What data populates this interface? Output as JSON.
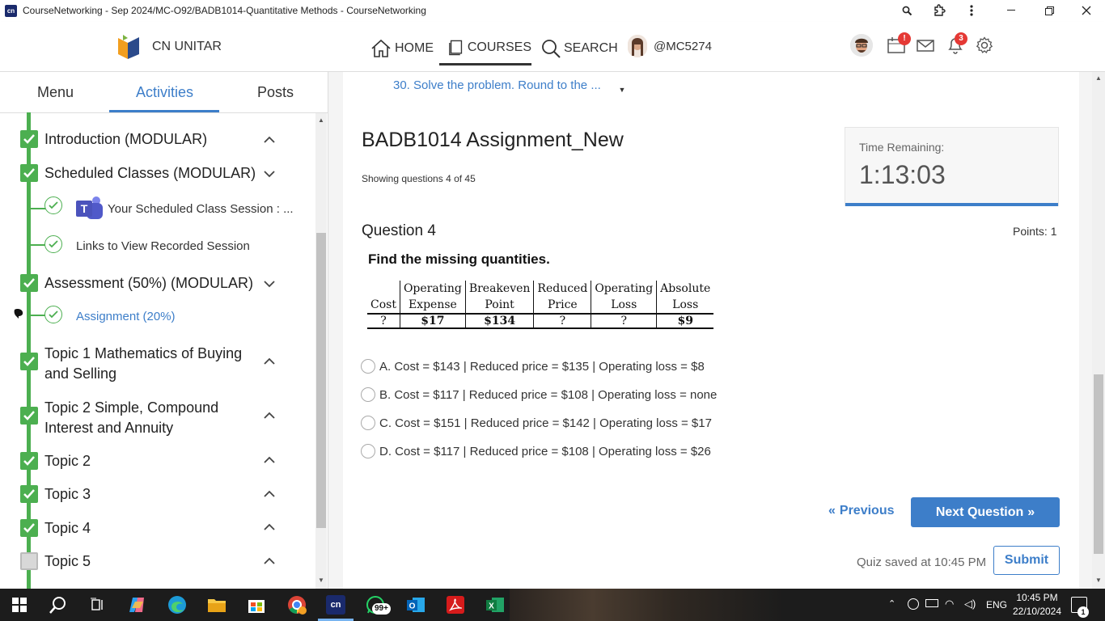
{
  "window": {
    "title": "CourseNetworking - Sep 2024/MC-O92/BADB1014-Quantitative Methods - CourseNetworking",
    "app_icon_text": "cn"
  },
  "header": {
    "brand": "CN UNITAR",
    "nav": {
      "home": "HOME",
      "courses": "COURSES",
      "search": "SEARCH"
    },
    "handle": "@MC5274",
    "calendar_badge": "!",
    "notification_badge": "3"
  },
  "sidebar": {
    "tabs": {
      "menu": "Menu",
      "activities": "Activities",
      "posts": "Posts"
    },
    "sections": [
      {
        "title": "Introduction (MODULAR)",
        "state": "done",
        "expanded": false
      },
      {
        "title": "Scheduled Classes (MODULAR)",
        "state": "done",
        "expanded": true
      },
      {
        "title": "Assessment (50%) (MODULAR)",
        "state": "done",
        "expanded": true
      },
      {
        "title": "Topic 1 Mathematics of Buying and Selling",
        "state": "done",
        "expanded": false
      },
      {
        "title": "Topic 2 Simple, Compound Interest and Annuity",
        "state": "done",
        "expanded": false
      },
      {
        "title": "Topic 2",
        "state": "done",
        "expanded": false
      },
      {
        "title": "Topic 3",
        "state": "done",
        "expanded": false
      },
      {
        "title": "Topic 4",
        "state": "done",
        "expanded": false
      },
      {
        "title": "Topic 5",
        "state": "pending",
        "expanded": false
      }
    ],
    "subitems": {
      "class_session": "Your Scheduled Class Session : ...",
      "recorded": "Links to View Recorded Session",
      "assignment": "Assignment (20%)"
    }
  },
  "main": {
    "question_select": "30. Solve the problem. Round to the ...",
    "quiz_title": "BADB1014 Assignment_New",
    "showing": "Showing questions 4 of 45",
    "timer": {
      "label": "Time Remaining:",
      "value": "1:13:03",
      "progress": 1.0
    },
    "question_number": "Question 4",
    "points": "Points: 1",
    "prompt": "Find the missing quantities.",
    "table": {
      "headers_top": [
        "",
        "Operating",
        "Breakeven",
        "Reduced",
        "Operating",
        "Absolute"
      ],
      "headers_bottom": [
        "Cost",
        "Expense",
        "Point",
        "Price",
        "Loss",
        "Loss"
      ],
      "row": [
        "?",
        "$17",
        "$134",
        "?",
        "?",
        "$9"
      ]
    },
    "options": [
      "A. Cost = $143 | Reduced price = $135 | Operating loss = $8",
      "B. Cost = $117 | Reduced price = $108 | Operating loss = none",
      "C. Cost = $151 | Reduced price = $142 | Operating loss = $17",
      "D. Cost = $117 | Reduced price = $108 | Operating loss = $26"
    ],
    "prev_label": "Previous",
    "next_label": "Next Question",
    "saved": "Quiz saved at 10:45 PM",
    "submit_label": "Submit"
  },
  "taskbar": {
    "whatsapp_badge": "99+",
    "lang": "ENG",
    "time": "10:45 PM",
    "date": "22/10/2024",
    "notification_count": "1"
  }
}
